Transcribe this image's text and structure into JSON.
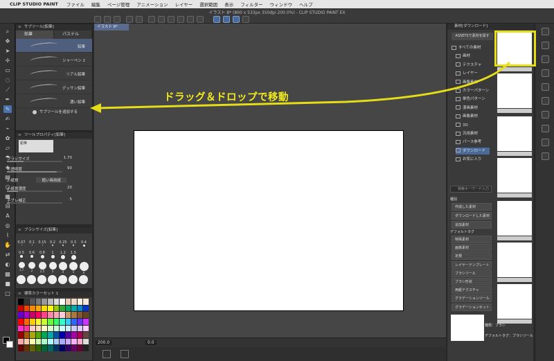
{
  "menubar": {
    "app": "CLIP STUDIO PAINT",
    "items": [
      "ファイル",
      "編集",
      "ページ管理",
      "アニメーション",
      "レイヤー",
      "選択範囲",
      "表示",
      "フィルター",
      "ウィンドウ",
      "ヘルプ"
    ]
  },
  "toolbar": {
    "doc_title": "イラスト 8* (800 x 533px 350dpi 200.0%) - CLIP STUDIO PAINT EX"
  },
  "canvas": {
    "tab": "イラスト 8*",
    "zoom": "200.0",
    "rotation": "0.0"
  },
  "subtool": {
    "title": "サブツール[鉛筆]",
    "tabs": [
      "鉛筆",
      "パステル"
    ],
    "items": [
      "鉛筆",
      "シャーペン 2",
      "リアル鉛筆",
      "デッサン鉛筆",
      "濃い鉛筆"
    ],
    "add_label": "サブツールを追加する"
  },
  "tool_property": {
    "title": "ツールプロパティ[鉛筆]",
    "preview_label": "鉛筆",
    "rows": [
      {
        "label": "ブラシサイズ",
        "value": "1.70",
        "fill": 0.3
      },
      {
        "label": "不透明度",
        "value": "90",
        "fill": 0.9
      },
      {
        "label": "2-紙質",
        "value": "粗い画用紙",
        "fill": 0
      },
      {
        "label": "2-紙質濃度",
        "value": "20",
        "fill": 0.2
      },
      {
        "label": "手ブレ補正",
        "value": "5",
        "fill": 0.05
      }
    ]
  },
  "brush_size": {
    "title": "ブラシサイズ[鉛筆]",
    "sizes_row1": [
      "0.07",
      "0.1",
      "0.15",
      "0.2",
      "0.25",
      "0.3",
      "0.4"
    ],
    "sizes_row2": [
      "0.5",
      "0.6",
      "0.8",
      "1",
      "1.2",
      "1.5"
    ],
    "sizes_row3": [
      "1.7",
      "2",
      "2.5",
      "3",
      "4",
      "5",
      "6"
    ]
  },
  "color_set": {
    "title": "標準カラーセット 1"
  },
  "material": {
    "title": "素材[ダウンロード]",
    "assets_label": "ASSETSで素材を探す",
    "tree": [
      "すべての素材",
      "画材",
      "テクスチャ",
      "レイヤー",
      "画像素材",
      "カラーパターン",
      "単色パターン",
      "漫画素材",
      "画像素材",
      "3D",
      "汎用素材",
      "パース参考",
      "ダウンロード",
      "お気に入り"
    ],
    "search_placeholder": "検索キーワード入力",
    "tags_label": "種別",
    "tags": [
      "作成した素材",
      "ダウンロードした素材",
      "追加素材"
    ],
    "default_tags_label": "デフォルトタグ",
    "default_tags": [
      "特殊素材",
      "画像素材",
      "定規",
      "レイヤーテンプレート",
      "ブラシツール",
      "ブラシ形状",
      "用紙テクスチャ",
      "グラデーションツール",
      "グラデーションセット"
    ],
    "info_kind": "種類：ブラシ",
    "info_default": "デフォルトタグ：ブラシツール"
  },
  "annotation": {
    "text": "ドラッグ＆ドロップで移動"
  },
  "colors": {
    "accent": "#e6dd1a",
    "selection": "#4a6a9a"
  }
}
